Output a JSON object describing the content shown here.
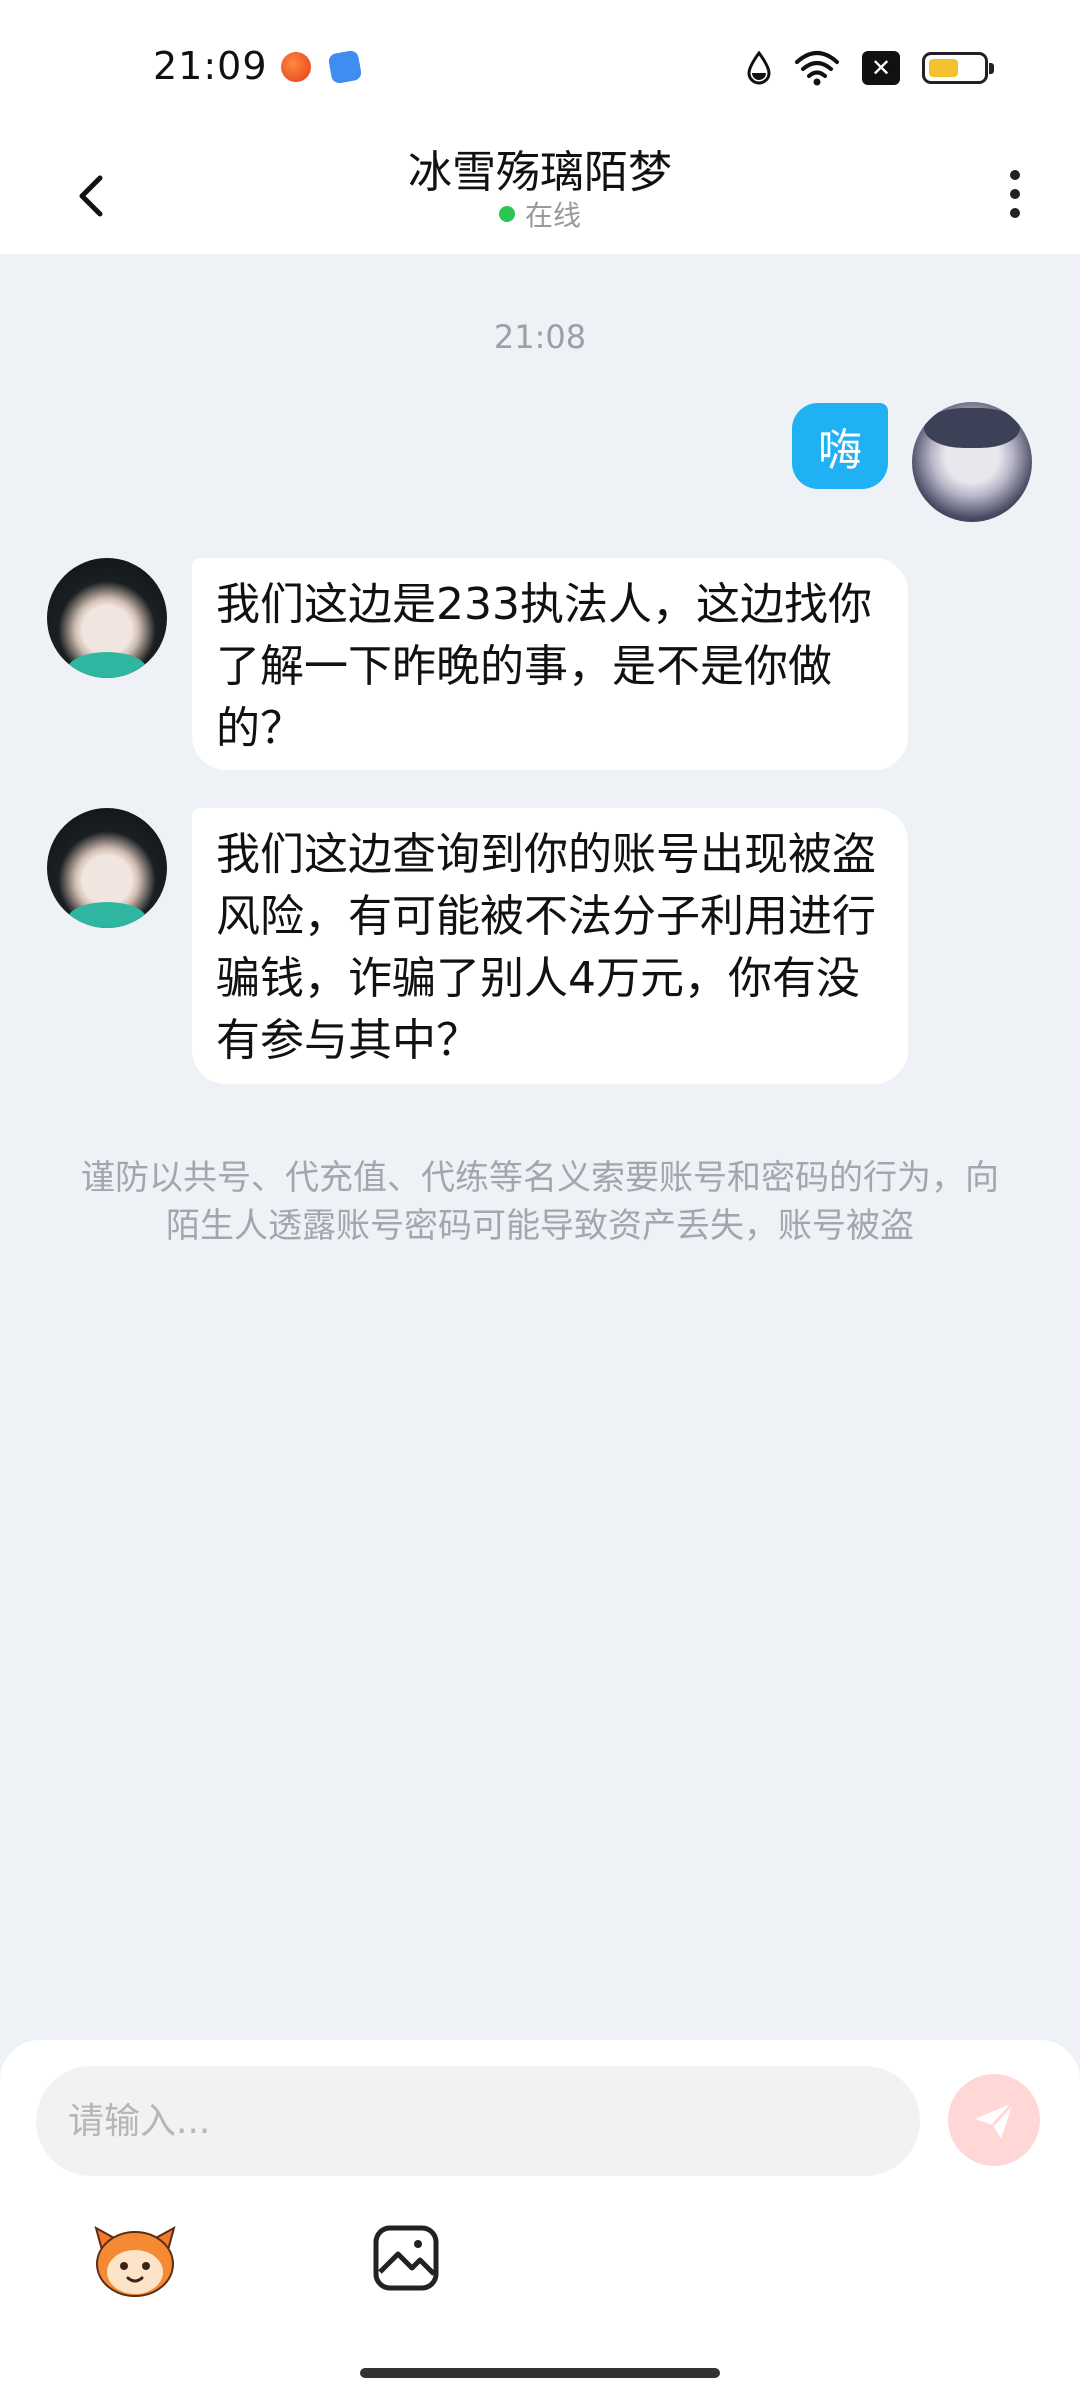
{
  "status_bar": {
    "time": "21:09"
  },
  "header": {
    "title": "冰雪殇璃陌梦",
    "status": "在线"
  },
  "chat": {
    "timestamp": "21:08",
    "messages": [
      {
        "from": "me",
        "text": "嗨"
      },
      {
        "from": "other",
        "text": "我们这边是233执法人，这边找你了解一下昨晚的事，是不是你做的？"
      },
      {
        "from": "other",
        "text": "我们这边查询到你的账号出现被盗风险，有可能被不法分子利用进行骗钱，诈骗了别人4万元，你有没有参与其中？"
      }
    ],
    "notice": "谨防以共号、代充值、代练等名义索要账号和密码的行为，向陌生人透露账号密码可能导致资产丢失，账号被盗"
  },
  "input": {
    "placeholder": "请输入..."
  },
  "colors": {
    "my_bubble": "#1fb1f3",
    "online_dot": "#2bc551",
    "send_button": "#ffd7d7",
    "background": "#eef2f6"
  },
  "icons": {
    "back": "chevron-left-icon",
    "more": "more-vertical-icon",
    "send": "send-icon",
    "emoji": "emoji-mascot-icon",
    "image": "image-icon"
  }
}
